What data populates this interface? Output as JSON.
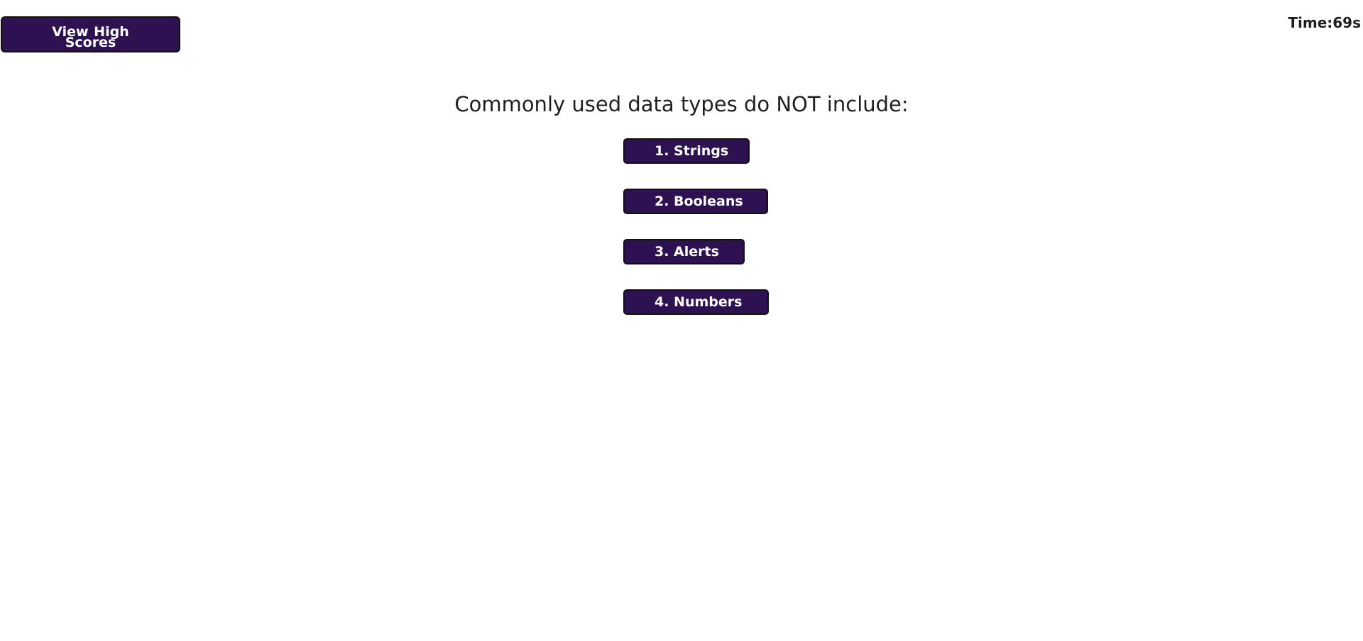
{
  "header": {
    "high_scores_label": "View High Scores",
    "timer_text": "Time:69s"
  },
  "quiz": {
    "question": "Commonly used data types do NOT include:",
    "choices": [
      {
        "label": "1. Strings"
      },
      {
        "label": "2. Booleans"
      },
      {
        "label": "3. Alerts"
      },
      {
        "label": "4. Numbers"
      }
    ]
  },
  "colors": {
    "button_bg": "#2d1150",
    "button_text": "#ffffff",
    "text": "#1f1f23",
    "background": "#ffffff"
  }
}
